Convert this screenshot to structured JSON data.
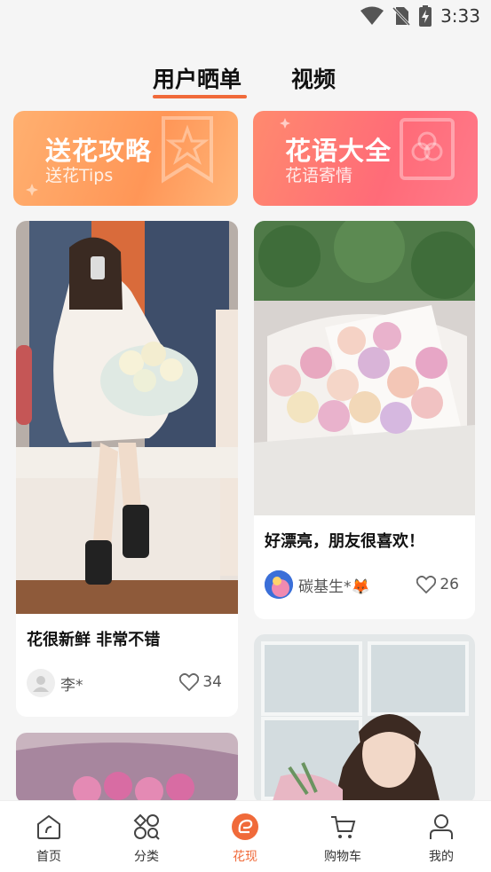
{
  "status_bar": {
    "time": "3:33"
  },
  "tabs": [
    {
      "label": "用户晒单",
      "active": true
    },
    {
      "label": "视频",
      "active": false
    }
  ],
  "banners": [
    {
      "title": "送花攻略",
      "subtitle": "送花Tips"
    },
    {
      "title": "花语大全",
      "subtitle": "花语寄情"
    }
  ],
  "posts": [
    {
      "title": "花很新鲜 非常不错",
      "author": "李*",
      "likes": "34"
    },
    {
      "title": "好漂亮，朋友很喜欢！",
      "author": "碳基生*🦊",
      "likes": "26"
    }
  ],
  "bottom_nav": [
    {
      "label": "首页",
      "icon": "home-icon"
    },
    {
      "label": "分类",
      "icon": "category-icon"
    },
    {
      "label": "花现",
      "icon": "discover-icon",
      "active": true
    },
    {
      "label": "购物车",
      "icon": "cart-icon"
    },
    {
      "label": "我的",
      "icon": "profile-icon"
    }
  ],
  "colors": {
    "accent": "#f06a3a",
    "banner_left": "#ff9e5e",
    "banner_right": "#ff7376"
  }
}
